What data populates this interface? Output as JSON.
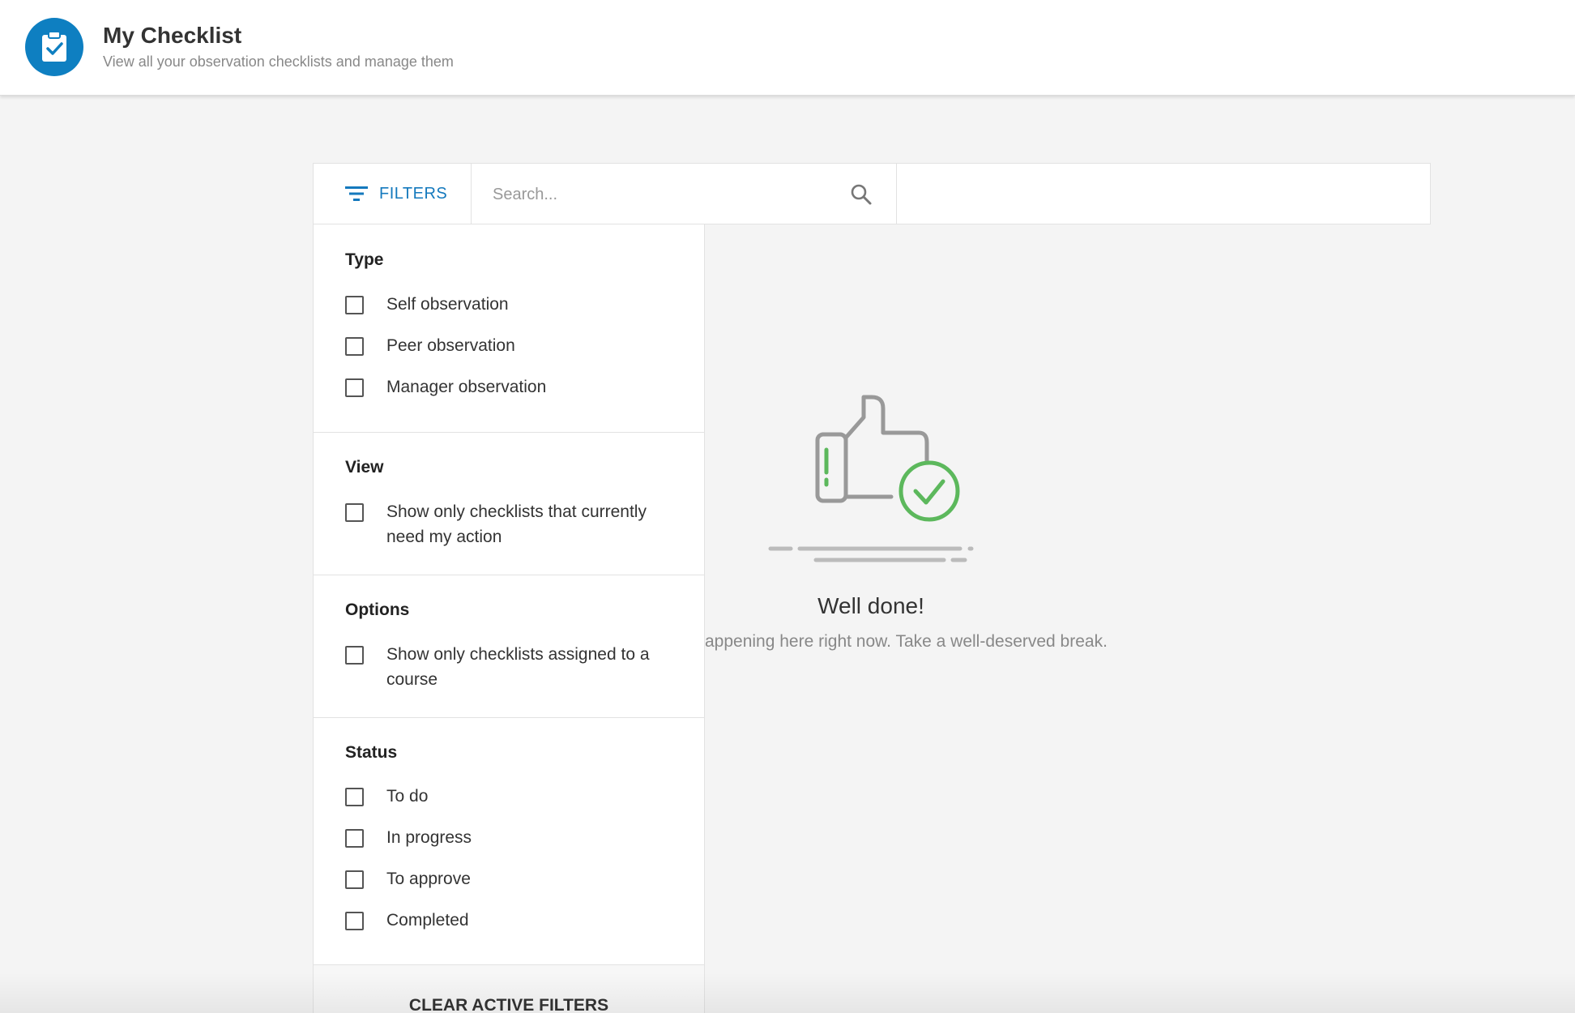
{
  "header": {
    "title": "My Checklist",
    "subtitle": "View all your observation checklists and manage them",
    "icon": "clipboard-check-icon"
  },
  "toolbar": {
    "filters_label": "FILTERS",
    "search_placeholder": "Search...",
    "search_value": ""
  },
  "filters": {
    "type": {
      "title": "Type",
      "options": [
        "Self observation",
        "Peer observation",
        "Manager observation"
      ]
    },
    "view": {
      "title": "View",
      "options": [
        "Show only checklists that currently need my action"
      ]
    },
    "options": {
      "title": "Options",
      "options": [
        "Show only checklists assigned to a course"
      ]
    },
    "status": {
      "title": "Status",
      "options": [
        "To do",
        "In progress",
        "To approve",
        "Completed"
      ]
    },
    "clear_label": "CLEAR ACTIVE FILTERS"
  },
  "empty_state": {
    "title": "Well done!",
    "message": "appening here right now. Take a well-deserved break."
  },
  "colors": {
    "accent": "#1479bd",
    "logo_bg": "#0e7fc1",
    "success": "#5cb85c",
    "background": "#f4f4f4"
  }
}
